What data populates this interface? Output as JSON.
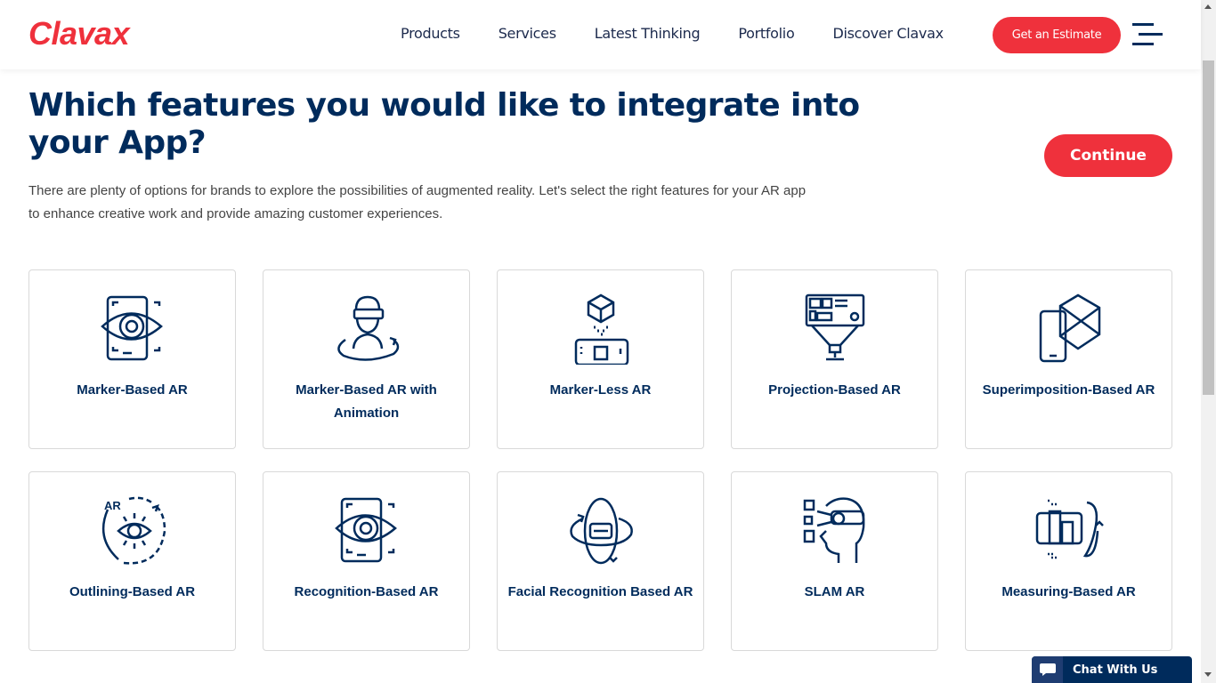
{
  "header": {
    "logo": "Clavax",
    "nav": [
      "Products",
      "Services",
      "Latest Thinking",
      "Portfolio",
      "Discover Clavax"
    ],
    "estimate_label": "Get an Estimate",
    "menu_icon": "hamburger-menu-icon"
  },
  "main": {
    "title": "Which features you would like to integrate into your App?",
    "description": "There are plenty of options for brands to explore the possibilities of augmented reality. Let's select the right features for your AR app to enhance creative work and provide amazing customer experiences.",
    "continue_label": "Continue",
    "features": [
      {
        "label": "Marker-Based AR",
        "icon": "phone-eye-icon"
      },
      {
        "label": "Marker-Based AR with Animation",
        "icon": "vr-person-rotate-icon"
      },
      {
        "label": "Marker-Less AR",
        "icon": "cube-phone-icon"
      },
      {
        "label": "Projection-Based AR",
        "icon": "projector-icon"
      },
      {
        "label": "Superimposition-Based AR",
        "icon": "phone-cube-overlay-icon"
      },
      {
        "label": "Outlining-Based AR",
        "icon": "ar-eye-circle-icon"
      },
      {
        "label": "Recognition-Based AR",
        "icon": "phone-eye-icon"
      },
      {
        "label": "Facial Recognition Based AR",
        "icon": "vr-headset-orbit-icon"
      },
      {
        "label": "SLAM AR",
        "icon": "head-vr-scan-icon"
      },
      {
        "label": "Measuring-Based AR",
        "icon": "phone-buildings-rotate-icon"
      }
    ]
  },
  "chat": {
    "label": "Chat With Us",
    "icon": "chat-bubble-icon"
  },
  "colors": {
    "brand_red": "#ef313c",
    "navy": "#002b5c"
  }
}
